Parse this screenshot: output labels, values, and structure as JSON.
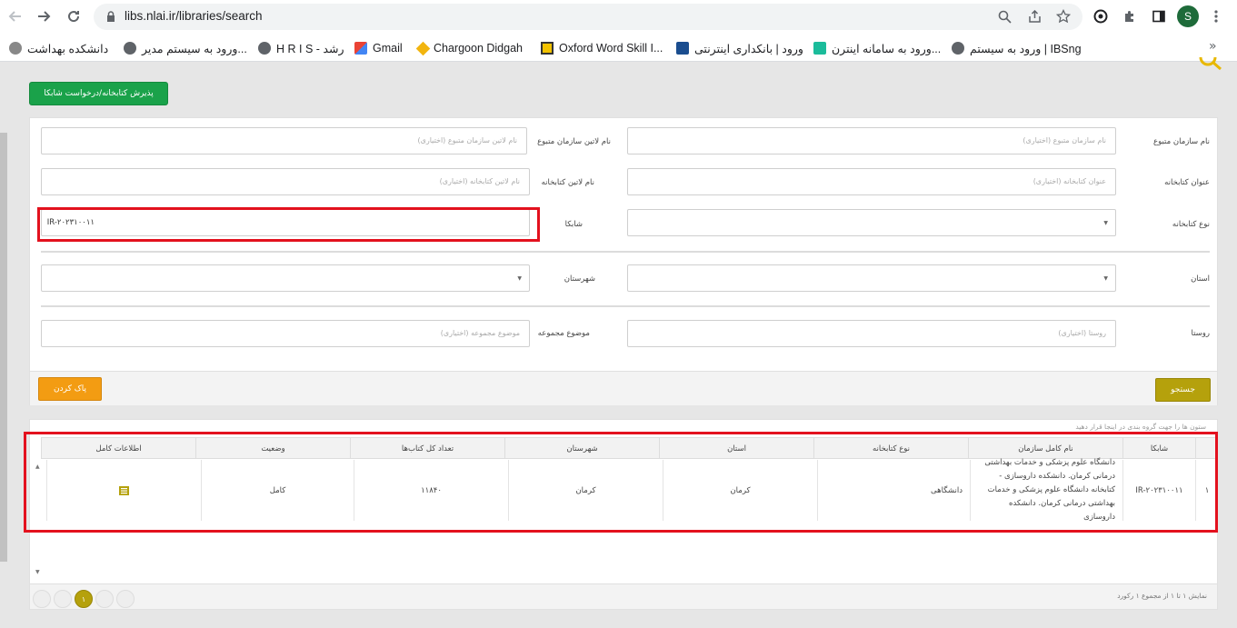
{
  "browser": {
    "url": "libs.nlai.ir/libraries/search",
    "avatar_letter": "S",
    "bookmarks": [
      {
        "label": "ورود به سیستم | IBSng"
      },
      {
        "label": "ورود به سامانه اینترن..."
      },
      {
        "label": "ورود | بانکداری اینترنتی"
      },
      {
        "label": "Oxford Word Skill I..."
      },
      {
        "label": "Chargoon Didgah"
      },
      {
        "label": "Gmail"
      },
      {
        "label": "H R I S - رشد"
      },
      {
        "label": "ورود به سیستم مدیر..."
      },
      {
        "label": "دانشکده بهداشت"
      }
    ],
    "more": "»"
  },
  "page": {
    "approve_button": "پذیرش کتابخانه/درخواست شابکا"
  },
  "form": {
    "org_name": {
      "label": "نام سازمان متبوع",
      "placeholder": "نام سازمان متبوع (اختیاری)"
    },
    "org_latin": {
      "label": "نام لاتین سازمان متبوع",
      "placeholder": "نام لاتین سازمان متبوع (اختیاری)"
    },
    "lib_title": {
      "label": "عنوان کتابخانه",
      "placeholder": "عنوان کتابخانه (اختیاری)"
    },
    "lib_latin": {
      "label": "نام لاتین کتابخانه",
      "placeholder": "نام لاتین کتابخانه (اختیاری)"
    },
    "lib_type": {
      "label": "نوع کتابخانه",
      "value": ""
    },
    "shabka": {
      "label": "شابکا",
      "value": "IR-۲۰۲۳۱۰۰۱۱"
    },
    "province": {
      "label": "استان",
      "value": ""
    },
    "city": {
      "label": "شهرستان",
      "value": ""
    },
    "village": {
      "label": "روستا",
      "placeholder": "روستا (اختیاری)"
    },
    "collection_subject": {
      "label": "موضوع مجموعه",
      "placeholder": "موضوع مجموعه (اختیاری)"
    },
    "search_button": "جستجو",
    "clear_button": "پاک کردن"
  },
  "grid": {
    "group_hint": "ستون ها را جهت گروه بندی در اینجا قرار دهید",
    "columns": {
      "shabka": "شابکا",
      "full_name": "نام کامل سازمان",
      "lib_type": "نوع کتابخانه",
      "province": "استان",
      "city": "شهرستان",
      "total_books": "تعداد کل کتاب‌ها",
      "status": "وضعیت",
      "full_info": "اطلاعات کامل"
    },
    "rows": [
      {
        "index": "۱",
        "shabka": "IR-۲۰۲۳۱۰۰۱۱",
        "full_name": "دانشگاه علوم پزشکی و خدمات بهداشتی درمانی کرمان. دانشکده داروسازی - کتابخانه دانشگاه علوم پزشکی و خدمات بهداشتی درمانی کرمان. دانشکده داروسازی",
        "lib_type": "دانشگاهی",
        "province": "کرمان",
        "city": "کرمان",
        "total_books": "۱۱۸۴۰",
        "status": "کامل"
      }
    ],
    "paging_info": "نمایش ۱ تا ۱ از مجموع ۱ رکورد",
    "current_page": "۱"
  },
  "colors": {
    "accent_green": "#1aa24a",
    "accent_olive": "#b5a10c",
    "accent_orange": "#f39c12",
    "highlight_red": "#e3111e"
  }
}
